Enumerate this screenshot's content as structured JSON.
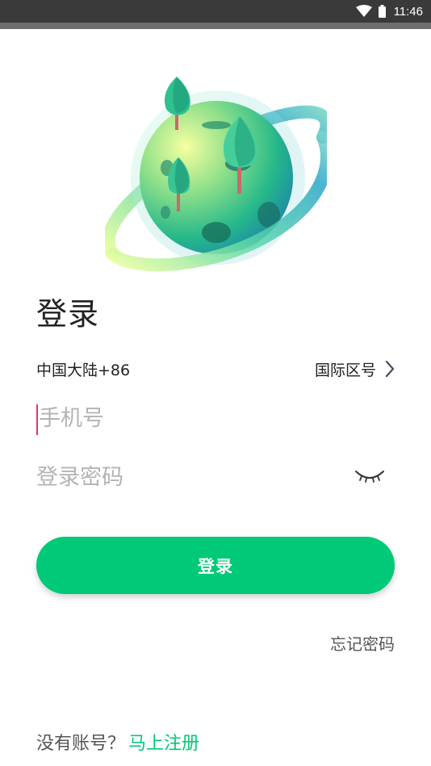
{
  "status_bar": {
    "time": "11:46",
    "icons": [
      "wifi-icon",
      "battery-icon"
    ]
  },
  "illustration": "planet-with-trees",
  "login": {
    "title": "登录",
    "country_code": "中国大陆+86",
    "intl_label": "国际区号",
    "phone_placeholder": "手机号",
    "password_placeholder": "登录密码",
    "submit_label": "登录",
    "forgot_label": "忘记密码",
    "no_account_label": "没有账号？",
    "register_label": "马上注册"
  },
  "colors": {
    "accent": "#00c977",
    "caret": "#e0356c",
    "placeholder": "#b3b3b3",
    "status_bar": "#3a3a3a"
  }
}
